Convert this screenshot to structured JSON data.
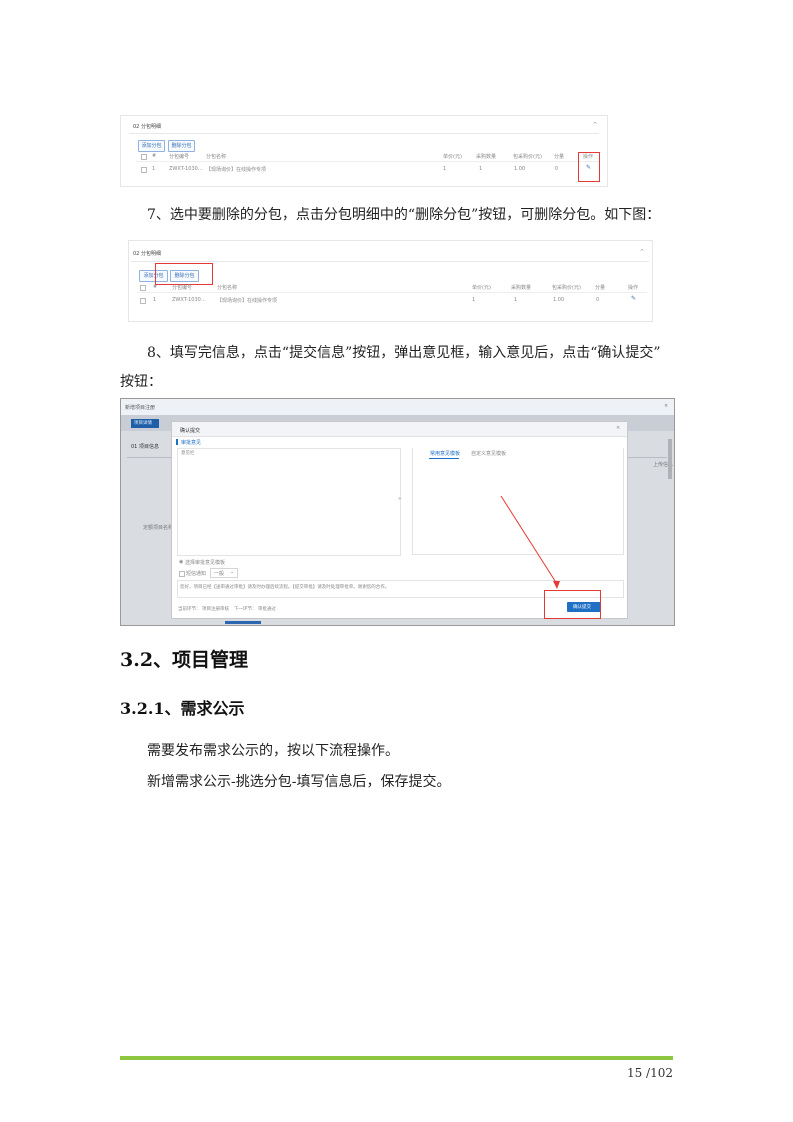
{
  "shot1": {
    "section": "02  分包明细",
    "collapse": "^",
    "buttons": {
      "add": "添加分包",
      "delete": "删除分包"
    },
    "columns": [
      "#",
      "分包编号",
      "分包名称",
      "单价(元)",
      "采购数量",
      "包采购价(元)",
      "分量",
      "操作"
    ],
    "row": [
      "1",
      "ZWXT-1030…",
      "【现场询价】在线操作专项",
      "1",
      "1",
      "1.00",
      "0"
    ],
    "edit_icon": "edit-icon"
  },
  "step7": "7、选中要删除的分包，点击分包明细中的“删除分包”按钮，可删除分包。如下图：",
  "shot2": {
    "section": "02  分包明细",
    "collapse": "^",
    "buttons": {
      "add": "添加分包",
      "delete": "删除分包"
    },
    "columns": [
      "#",
      "分包编号",
      "分包名称",
      "单价(元)",
      "采购数量",
      "包采购价(元)",
      "分量",
      "操作"
    ],
    "row": [
      "1",
      "ZWXT-1030…",
      "【现场询价】在线操作专项",
      "1",
      "1",
      "1.00",
      "0"
    ],
    "edit_icon": "edit-icon"
  },
  "step8_line1": "8、填写完信息，点击“提交信息”按钮，弹出意见框，输入意见后，点击“确认提交”",
  "step8_line2": "按钮：",
  "shot3": {
    "window_title": "新增项目注册",
    "tab": "项目详情",
    "section": "01  项目信息",
    "left_label": "定额项目名称",
    "right_label": "上传信息",
    "modal": {
      "title": "确认提交",
      "subtitle": "审批意见",
      "comment_label": "意见栏",
      "tabs": [
        "常用意见模板",
        "自定义意见模板"
      ],
      "radio_label": "选择审批意见模板",
      "priority_label": "短信通知",
      "priority_value": "一般",
      "message": "您好，项目已经【送审通过审批】请及时办理后续流程。【提交审批】请及时处理审批单。谢谢您的合作。",
      "footer_left_label": "当前环节：",
      "footer_left_value": "项目注册审核",
      "footer_right_label": "下一环节：",
      "footer_right_value": "审批通过",
      "confirm_button": "确认提交"
    }
  },
  "heading_3_2": "3.2、项目管理",
  "heading_3_2_1": "3.2.1、需求公示",
  "para1": "需要发布需求公示的，按以下流程操作。",
  "para2": "新增需求公示-挑选分包-填写信息后，保存提交。",
  "page_number": "15 /102",
  "colors": {
    "accent_green": "#8dc63f",
    "highlight_red": "#e53935",
    "ui_blue": "#1f6fc5"
  }
}
